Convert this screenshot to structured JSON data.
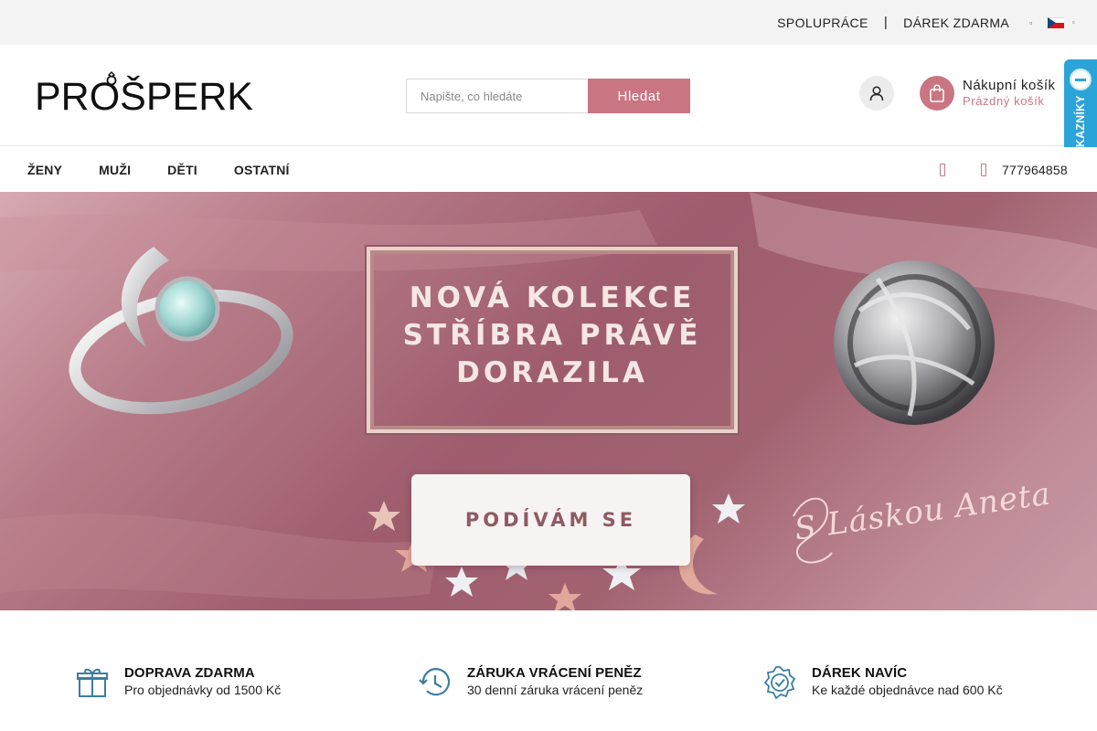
{
  "topbar": {
    "links": [
      "SPOLUPRÁCE",
      "DÁREK ZDARMA"
    ],
    "separator": "|",
    "language": "CZ"
  },
  "header": {
    "logo": "PROŠPERK",
    "search": {
      "placeholder": "Napište, co hledáte",
      "button_label": "Hledat"
    },
    "cart": {
      "title": "Nákupní košík",
      "status": "Prázdný košík"
    }
  },
  "verified_badge": {
    "label": "OVĚŘENO ZÁKAZNÍKY"
  },
  "nav": {
    "items": [
      "ŽENY",
      "MUŽI",
      "DĚTI",
      "OSTATNÍ"
    ],
    "phone": "777964858"
  },
  "hero": {
    "headline": "NOVÁ KOLEKCE\nSTŘÍBRA PRÁVĚ\nDORAZILA",
    "cta": "PODÍVÁM SE",
    "signature": "S Láskou Aneta"
  },
  "features": [
    {
      "icon": "gift-icon",
      "title": "DOPRAVA ZDARMA",
      "subtitle": "Pro objednávky od 1500 Kč"
    },
    {
      "icon": "history-icon",
      "title": "ZÁRUKA VRÁCENÍ PENĚZ",
      "subtitle": "30 denní záruka vrácení peněz"
    },
    {
      "icon": "verified-badge-icon",
      "title": "DÁREK NAVÍC",
      "subtitle": "Ke každé objednávce nad 600 Kč"
    }
  ],
  "colors": {
    "accent": "#c97682",
    "topbar_bg": "#f3f3f3",
    "badge_blue": "#2aa4d9",
    "feature_icon": "#3d7ea0"
  }
}
